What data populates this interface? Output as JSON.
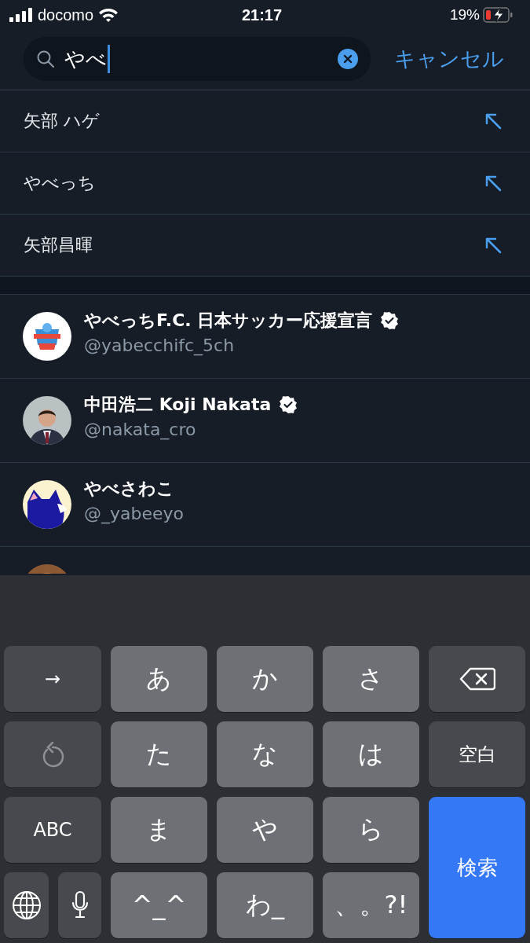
{
  "status_bar": {
    "carrier": "docomo",
    "time": "21:17",
    "battery": "19%",
    "charging": true
  },
  "search": {
    "value": "やべ",
    "cancel": "キャンセル"
  },
  "suggestions": [
    {
      "text": "矢部 ハゲ"
    },
    {
      "text": "やべっち"
    },
    {
      "text": "矢部昌暉"
    }
  ],
  "users": [
    {
      "name": "やべっちF.C. 日本サッカー応援宣言",
      "verified": true,
      "handle": "@yabecchifc_5ch",
      "avatar": {
        "kind": "picture"
      }
    },
    {
      "name": "中田浩二 Koji Nakata",
      "verified": true,
      "handle": "@nakata_cro",
      "avatar": {
        "kind": "picture"
      }
    },
    {
      "name": "やべさわこ",
      "verified": false,
      "handle": "@_yabeeyo",
      "avatar": {
        "kind": "picture"
      }
    },
    {
      "avatar": {
        "kind": "picture"
      }
    }
  ],
  "keyboard": {
    "rows": [
      [
        {
          "kind": "func",
          "label": "→",
          "colspan": 2
        },
        {
          "kind": "char",
          "label": "あ"
        },
        {
          "kind": "char",
          "label": "か"
        },
        {
          "kind": "char",
          "label": "さ"
        },
        {
          "kind": "backspace"
        }
      ],
      [
        {
          "kind": "undo",
          "colspan": 2
        },
        {
          "kind": "char",
          "label": "た"
        },
        {
          "kind": "char",
          "label": "な"
        },
        {
          "kind": "char",
          "label": "は"
        },
        {
          "kind": "func",
          "label": "空白"
        }
      ],
      [
        {
          "kind": "func",
          "label": "ABC",
          "colspan": 2
        },
        {
          "kind": "char",
          "label": "ま"
        },
        {
          "kind": "char",
          "label": "や"
        },
        {
          "kind": "char",
          "label": "ら"
        },
        {
          "kind": "search",
          "label": "検索",
          "rowspan": 2
        }
      ],
      [
        {
          "kind": "globe"
        },
        {
          "kind": "mic"
        },
        {
          "kind": "char",
          "label": "^_^"
        },
        {
          "kind": "char",
          "label": "わ_"
        },
        {
          "kind": "char",
          "label": "、。?!"
        }
      ]
    ]
  }
}
